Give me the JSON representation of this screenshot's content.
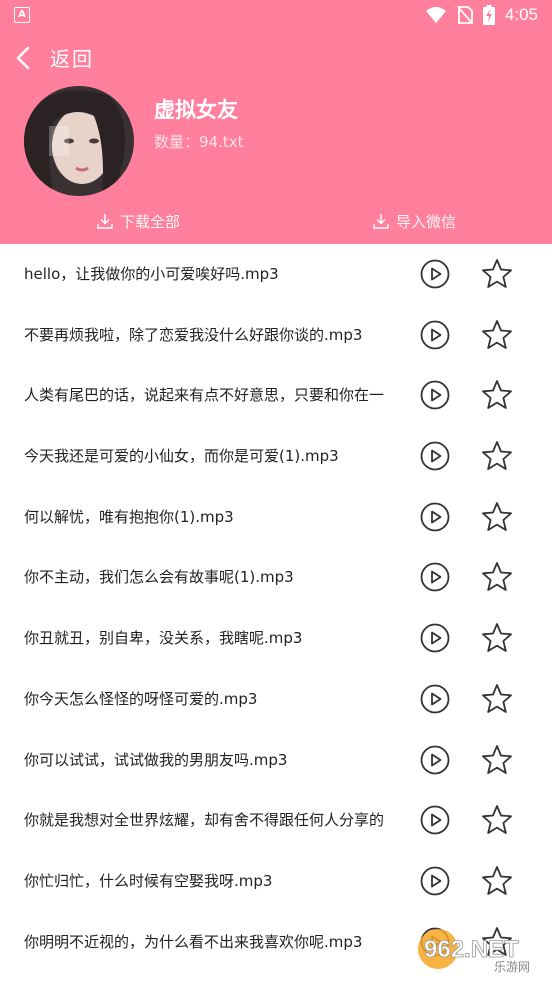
{
  "status_bar": {
    "time": "4:05",
    "left_badge": "A"
  },
  "header": {
    "back_label": "返回",
    "title": "虚拟女友",
    "count_text": "数量：94.txt",
    "download_all_label": "下载全部",
    "import_wechat_label": "导入微信"
  },
  "tracks": [
    {
      "title": "hello，让我做你的小可爱唉好吗.mp3"
    },
    {
      "title": "不要再烦我啦，除了恋爱我没什么好跟你谈的.mp3"
    },
    {
      "title": "人类有尾巴的话，说起来有点不好意思，只要和你在一"
    },
    {
      "title": "今天我还是可爱的小仙女，而你是可爱(1).mp3"
    },
    {
      "title": "何以解忧，唯有抱抱你(1).mp3"
    },
    {
      "title": "你不主动，我们怎么会有故事呢(1).mp3"
    },
    {
      "title": "你丑就丑，别自卑，没关系，我瞎呢.mp3"
    },
    {
      "title": "你今天怎么怪怪的呀怪可爱的.mp3"
    },
    {
      "title": "你可以试试，试试做我的男朋友吗.mp3"
    },
    {
      "title": "你就是我想对全世界炫耀，却有舍不得跟任何人分享的"
    },
    {
      "title": "你忙归忙，什么时候有空娶我呀.mp3"
    },
    {
      "title": "你明明不近视的，为什么看不出来我喜欢你呢.mp3"
    }
  ],
  "watermark": {
    "brand": "962.NET",
    "subtitle": "乐游网"
  },
  "colors": {
    "header_bg": "#ff7f9c",
    "icon": "#333333"
  }
}
